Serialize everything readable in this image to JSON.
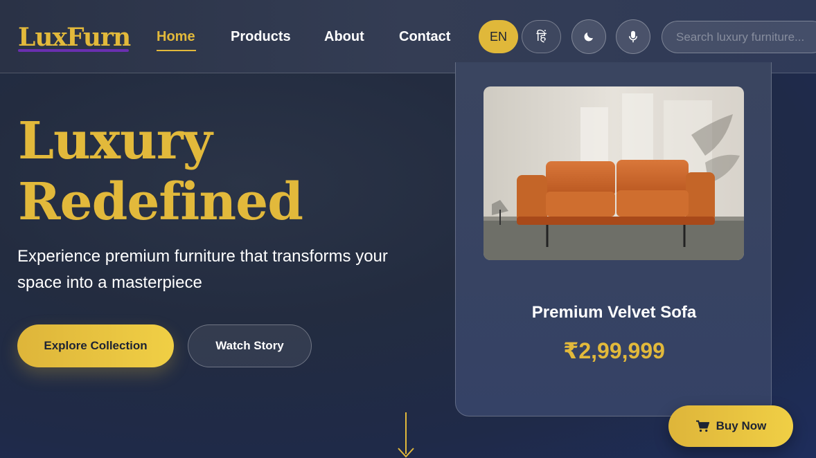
{
  "brand": {
    "logo": "LuxFurn"
  },
  "nav": {
    "links": [
      "Home",
      "Products",
      "About",
      "Contact"
    ],
    "active": "Home",
    "lang_en": "EN",
    "lang_hi": "हिं",
    "search_placeholder": "Search luxury furniture..."
  },
  "icons": {
    "theme": "moon-icon",
    "voice": "microphone-icon",
    "cart": "cart-icon",
    "scroll": "arrow-down-icon"
  },
  "hero": {
    "title_line1": "Luxury",
    "title_line2": "Redefined",
    "subtitle": "Experience premium furniture that transforms your space into a masterpiece",
    "primary_cta": "Explore Collection",
    "secondary_cta": "Watch Story"
  },
  "product": {
    "name": "Premium Velvet Sofa",
    "price": "₹2,99,999",
    "image": "orange-leather-sofa-photo"
  },
  "buy_now": "Buy Now",
  "colors": {
    "accent_gold": "#e2b93b",
    "bg_navy": "#232c40",
    "logo_underline": "#6a2fb0"
  }
}
